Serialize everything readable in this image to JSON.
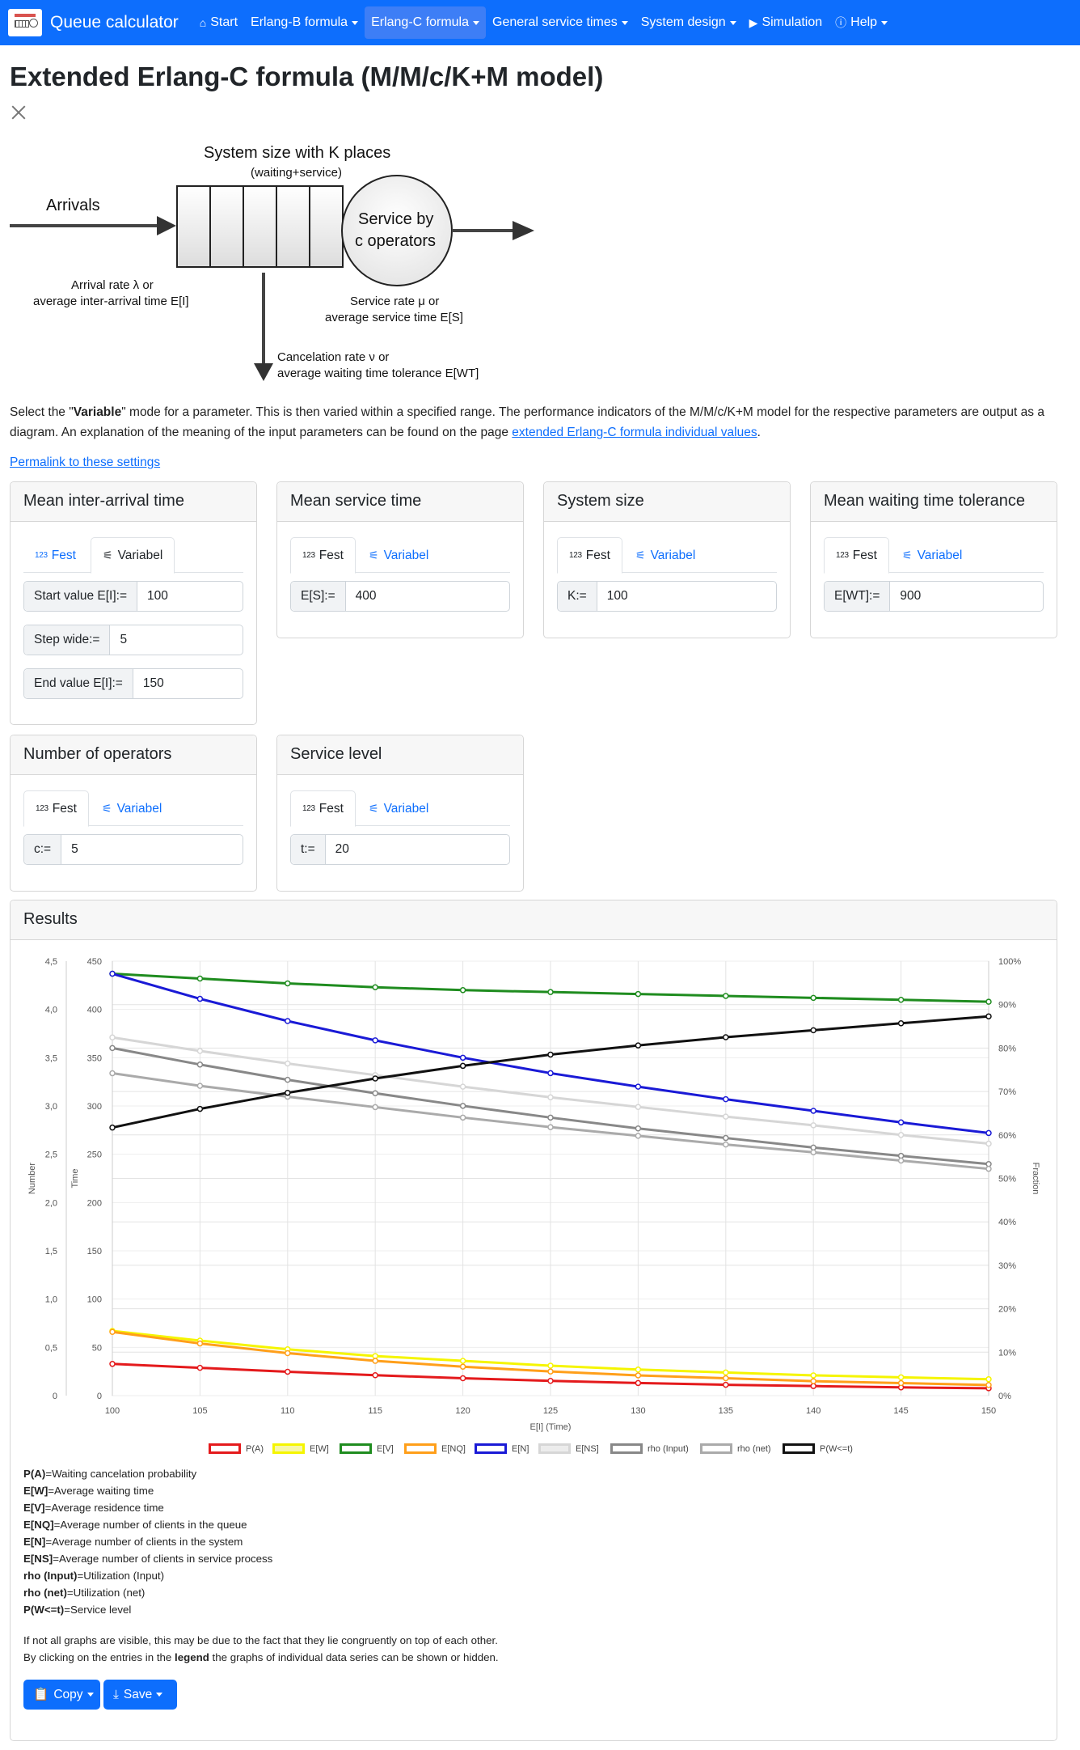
{
  "nav": {
    "brand": "Queue calculator",
    "items": [
      {
        "label": "Start",
        "icon": "home-icon",
        "dropdown": false,
        "active": false
      },
      {
        "label": "Erlang-B formula",
        "icon": "",
        "dropdown": true,
        "active": false
      },
      {
        "label": "Erlang-C formula",
        "icon": "",
        "dropdown": true,
        "active": true
      },
      {
        "label": "General service times",
        "icon": "",
        "dropdown": true,
        "active": false
      },
      {
        "label": "System design",
        "icon": "",
        "dropdown": true,
        "active": false
      },
      {
        "label": "Simulation",
        "icon": "play-icon",
        "dropdown": false,
        "active": false
      },
      {
        "label": "Help",
        "icon": "help-icon",
        "dropdown": true,
        "active": false
      }
    ]
  },
  "page": {
    "title": "Extended Erlang-C formula (M/M/c/K+M model)"
  },
  "diagram": {
    "system_size": "System size with K places",
    "waiting_service": "(waiting+service)",
    "arrivals": "Arrivals",
    "service_line1": "Service by",
    "service_line2": "c operators",
    "arrival_rate_1": "Arrival rate λ or",
    "arrival_rate_2": "average inter-arrival time E[I]",
    "service_rate_1": "Service rate μ or",
    "service_rate_2": "average service time E[S]",
    "cancel_1": "Cancelation rate ν or",
    "cancel_2": "average waiting time tolerance E[WT]"
  },
  "intro": {
    "text_a": "Select the \"",
    "text_bold": "Variable",
    "text_b": "\" mode for a parameter. This is then varied within a specified range. The performance indicators of the M/M/c/K+M model for the respective parameters are output as a diagram. An explanation of the meaning of the input parameters can be found on the page ",
    "link": "extended Erlang-C formula individual values",
    "text_c": ".",
    "permalink": "Permalink to these settings"
  },
  "tabs": {
    "fixed": "Fest",
    "fixed_icon": "123",
    "variable": "Variabel"
  },
  "cards": {
    "inter_arrival": {
      "title": "Mean inter-arrival time",
      "start_label": "Start value E[I]:=",
      "start_value": "100",
      "step_label": "Step wide:=",
      "step_value": "5",
      "end_label": "End value E[I]:=",
      "end_value": "150"
    },
    "service_time": {
      "title": "Mean service time",
      "label": "E[S]:=",
      "value": "400"
    },
    "system_size": {
      "title": "System size",
      "label": "K:=",
      "value": "100"
    },
    "tolerance": {
      "title": "Mean waiting time tolerance",
      "label": "E[WT]:=",
      "value": "900"
    },
    "operators": {
      "title": "Number of operators",
      "label": "c:=",
      "value": "5"
    },
    "service_level": {
      "title": "Service level",
      "label": "t:=",
      "value": "20"
    }
  },
  "results": {
    "title": "Results",
    "definitions": [
      {
        "key": "P(A)",
        "text": "=Waiting cancelation probability"
      },
      {
        "key": "E[W]",
        "text": "=Average waiting time"
      },
      {
        "key": "E[V]",
        "text": "=Average residence time"
      },
      {
        "key": "E[NQ]",
        "text": "=Average number of clients in the queue"
      },
      {
        "key": "E[N]",
        "text": "=Average number of clients in the system"
      },
      {
        "key": "E[NS]",
        "text": "=Average number of clients in service process"
      },
      {
        "key": "rho (Input)",
        "text": "=Utilization (Input)"
      },
      {
        "key": "rho (net)",
        "text": "=Utilization (net)"
      },
      {
        "key": "P(W<=t)",
        "text": "=Service level"
      }
    ],
    "note_1": "If not all graphs are visible, this may be due to the fact that they lie congruently on top of each other.",
    "note_2a": "By clicking on the entries in the ",
    "note_2b": "legend",
    "note_2c": " the graphs of individual data series can be shown or hidden.",
    "copy": "Copy",
    "save": "Save"
  },
  "chart_data": {
    "type": "line",
    "xlabel": "E[I] (Time)",
    "y_number_label": "Number",
    "y_time_label": "Time",
    "y_fraction_label": "Fraction",
    "x": [
      100,
      105,
      110,
      115,
      120,
      125,
      130,
      135,
      140,
      145,
      150
    ],
    "xlim": [
      100,
      150
    ],
    "x_ticks": [
      "100",
      "105",
      "110",
      "115",
      "120",
      "125",
      "130",
      "135",
      "140",
      "145",
      "150"
    ],
    "y_number_ticks": [
      "0",
      "0,5",
      "1,0",
      "1,5",
      "2,0",
      "2,5",
      "3,0",
      "3,5",
      "4,0",
      "4,5"
    ],
    "y_number_lim": [
      0,
      4.5
    ],
    "y_time_ticks": [
      "0",
      "50",
      "100",
      "150",
      "200",
      "250",
      "300",
      "350",
      "400",
      "450"
    ],
    "y_time_lim": [
      0,
      450
    ],
    "y_fraction_ticks": [
      "0%",
      "10%",
      "20%",
      "30%",
      "40%",
      "50%",
      "60%",
      "70%",
      "80%",
      "90%",
      "100%"
    ],
    "y_fraction_lim": [
      0,
      1
    ],
    "grid": true,
    "legend_position": "bottom",
    "series": [
      {
        "name": "P(A)",
        "axis": "fraction",
        "color": "#e41a1c",
        "values": [
          0.073,
          0.064,
          0.055,
          0.047,
          0.04,
          0.034,
          0.029,
          0.025,
          0.022,
          0.019,
          0.017
        ]
      },
      {
        "name": "E[W]",
        "axis": "time",
        "color": "#f5f500",
        "values": [
          67,
          57,
          48,
          41,
          36,
          31,
          27,
          24,
          21,
          19,
          17
        ]
      },
      {
        "name": "E[V]",
        "axis": "time",
        "color": "#1f8c1f",
        "values": [
          437,
          432,
          427,
          423,
          420,
          418,
          416,
          414,
          412,
          410,
          408
        ]
      },
      {
        "name": "E[NQ]",
        "axis": "number",
        "color": "#ff9f1a",
        "values": [
          0.66,
          0.54,
          0.44,
          0.36,
          0.3,
          0.25,
          0.21,
          0.18,
          0.15,
          0.13,
          0.11
        ]
      },
      {
        "name": "E[N]",
        "axis": "number",
        "color": "#1a1ad6",
        "values": [
          4.37,
          4.11,
          3.88,
          3.68,
          3.5,
          3.34,
          3.2,
          3.07,
          2.95,
          2.83,
          2.72
        ]
      },
      {
        "name": "E[NS]",
        "axis": "number",
        "color": "#d6d6d6",
        "values": [
          3.71,
          3.57,
          3.44,
          3.32,
          3.2,
          3.09,
          2.99,
          2.89,
          2.8,
          2.7,
          2.61
        ]
      },
      {
        "name": "rho (Input)",
        "axis": "fraction",
        "color": "#888888",
        "values": [
          0.8,
          0.762,
          0.727,
          0.696,
          0.667,
          0.64,
          0.615,
          0.593,
          0.571,
          0.552,
          0.533
        ]
      },
      {
        "name": "rho (net)",
        "axis": "fraction",
        "color": "#aaaaaa",
        "values": [
          0.742,
          0.713,
          0.688,
          0.664,
          0.64,
          0.618,
          0.598,
          0.578,
          0.56,
          0.541,
          0.522
        ]
      },
      {
        "name": "P(W<=t)",
        "axis": "fraction",
        "color": "#111111",
        "values": [
          0.617,
          0.66,
          0.697,
          0.73,
          0.759,
          0.785,
          0.806,
          0.825,
          0.841,
          0.857,
          0.873
        ]
      }
    ]
  }
}
